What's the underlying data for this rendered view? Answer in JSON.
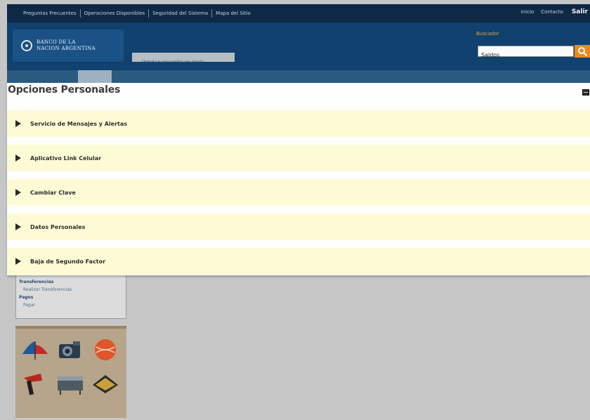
{
  "top_links": [
    "Preguntas Frecuentes",
    "Operaciones Disponibles",
    "Seguridad del Sistema",
    "Mapa del Sitio"
  ],
  "top_right": {
    "inicio": "Inicio",
    "contacto": "Contacto",
    "salir": "Salir"
  },
  "logo": {
    "line1": "BANCO DE LA",
    "line2": "NACION ARGENTINA"
  },
  "user_info": "Usted se encuentra en: Inicio",
  "search": {
    "label": "Buscador",
    "value": "Saldos"
  },
  "overlay": {
    "title": "Opciones Personales",
    "options": [
      {
        "label": "Servicio de Mensajes y Alertas"
      },
      {
        "label": "Aplicativo Link Celular"
      },
      {
        "label": "Cambiar Clave"
      },
      {
        "label": "Datos Personales"
      },
      {
        "label": "Baja de Segundo Factor"
      }
    ]
  },
  "sidebar": {
    "lines": [
      {
        "text": "Transferencias"
      },
      {
        "text": "Realizar Transferencias"
      },
      {
        "text": "Pagos"
      },
      {
        "text": "Pagar"
      }
    ]
  },
  "colors": {
    "header_bg": "#10416f",
    "topbar_bg": "#0e2845",
    "option_bg": "#fdfbd5",
    "search_button": "#f0861c"
  },
  "icons": {
    "search_button": "search-icon",
    "close": "close-icon",
    "expand": "triangle-right-icon"
  }
}
